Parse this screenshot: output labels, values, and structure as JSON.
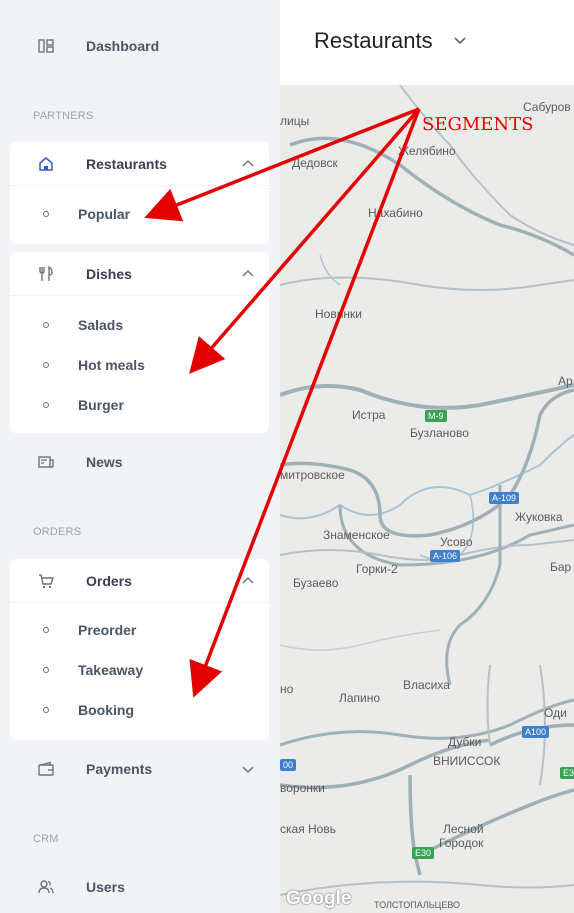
{
  "sidebar": {
    "dashboard": {
      "label": "Dashboard",
      "icon": "dashboard-icon"
    },
    "sections": {
      "partners": "PARTNERS",
      "orders": "ORDERS",
      "crm": "CRM"
    },
    "restaurants": {
      "label": "Restaurants",
      "icon": "home-icon",
      "items": [
        {
          "label": "Popular"
        }
      ]
    },
    "dishes": {
      "label": "Dishes",
      "icon": "fork-knife-icon",
      "items": [
        {
          "label": "Salads"
        },
        {
          "label": "Hot meals"
        },
        {
          "label": "Burger"
        }
      ]
    },
    "news": {
      "label": "News",
      "icon": "newspaper-icon"
    },
    "orders": {
      "label": "Orders",
      "icon": "cart-icon",
      "items": [
        {
          "label": "Preorder"
        },
        {
          "label": "Takeaway"
        },
        {
          "label": "Booking"
        }
      ]
    },
    "payments": {
      "label": "Payments",
      "icon": "wallet-icon"
    },
    "users": {
      "label": "Users",
      "icon": "users-icon"
    }
  },
  "header": {
    "title": "Restaurants"
  },
  "map": {
    "places": [
      "Сабуров",
      "лицы",
      "Дедовск",
      "Желябино",
      "Нахабино",
      "Новинки",
      "Ар",
      "Истра",
      "Бузланово",
      "митровское",
      "Жуковка",
      "Знаменское",
      "Усово",
      "Горки-2",
      "Бузаево",
      "Бар",
      "но",
      "Лапино",
      "Власиха",
      "Оди",
      "Дубки",
      "ВНИИССОК",
      "00",
      "воронки",
      "ская Новь",
      "Лесной",
      "Городок",
      "ТОЛСТОПАЛЬЦЕВО"
    ],
    "roads": [
      "M-9",
      "A-109",
      "A-106",
      "A100",
      "E3",
      "E30"
    ],
    "attribution": "Google"
  },
  "annotation": {
    "label": "SEGMENTS",
    "color": "#e40000"
  },
  "colors": {
    "sidebar_bg": "#f2f3f7",
    "card_bg": "#ffffff",
    "text": "#4b5563",
    "map_bg": "#ebebe9",
    "road": "#9fb0b7",
    "water": "#aac4d6",
    "highway_shield": "#3f7fcf",
    "euro_shield": "#3aa152"
  }
}
